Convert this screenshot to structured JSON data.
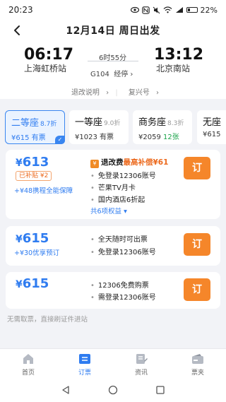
{
  "status_bar": {
    "time": "20:23",
    "battery": "22%",
    "icons": [
      "eye-icon",
      "nfc-icon",
      "mute-icon",
      "wifi-icon",
      "signal-icon",
      "battery-icon"
    ]
  },
  "header": {
    "title": "12月14日 周日出发"
  },
  "train": {
    "departure_time": "06:17",
    "departure_station": "上海虹桥站",
    "arrival_time": "13:12",
    "arrival_station": "北京南站",
    "duration": "6时55分",
    "train_no": "G104",
    "stops_label": "经停",
    "refund_label": "退改说明",
    "fuxing_label": "复兴号"
  },
  "seat_tabs": [
    {
      "name": "二等座",
      "discount": "8.7折",
      "price": "¥615",
      "availability": "有票",
      "selected": true
    },
    {
      "name": "一等座",
      "discount": "9.0折",
      "price": "¥1023",
      "availability": "有票",
      "selected": false
    },
    {
      "name": "商务座",
      "discount": "8.3折",
      "price": "¥2059",
      "availability": "12张",
      "selected": false
    },
    {
      "name": "无座",
      "discount": "",
      "price": "¥615",
      "availability": "",
      "selected": false
    }
  ],
  "fares": [
    {
      "yen": "¥",
      "price": "613",
      "subsidy_tag": "已补贴 ¥2",
      "extra_link": "+¥48携程全能保障",
      "refund_title_prefix": "退改费",
      "refund_title_highlight": "最高补偿¥61",
      "refund_badge": "¥",
      "benefits": [
        "免登录12306账号",
        "芒果TV月卡",
        "国内酒店6折起"
      ],
      "more": "共6项权益",
      "book_label": "订"
    },
    {
      "yen": "¥",
      "price": "615",
      "extra_link": "+¥30优享预订",
      "benefits": [
        "全天随时可出票",
        "免登录12306账号"
      ],
      "book_label": "订"
    },
    {
      "yen": "¥",
      "price": "615",
      "benefits": [
        "12306免费购票",
        "需登录12306账号"
      ],
      "book_label": "订"
    }
  ],
  "footnote": "无需取票，直接刷证件进站",
  "bottom_nav": [
    {
      "label": "首页",
      "icon": "home-icon",
      "active": false
    },
    {
      "label": "订票",
      "icon": "ticket-icon",
      "active": true
    },
    {
      "label": "资讯",
      "icon": "news-icon",
      "active": false
    },
    {
      "label": "票夹",
      "icon": "wallet-icon",
      "active": false
    }
  ],
  "colors": {
    "accent_blue": "#2f7cf0",
    "orange": "#f5862a",
    "green": "#1aa34a",
    "background": "#f2f3f7"
  }
}
